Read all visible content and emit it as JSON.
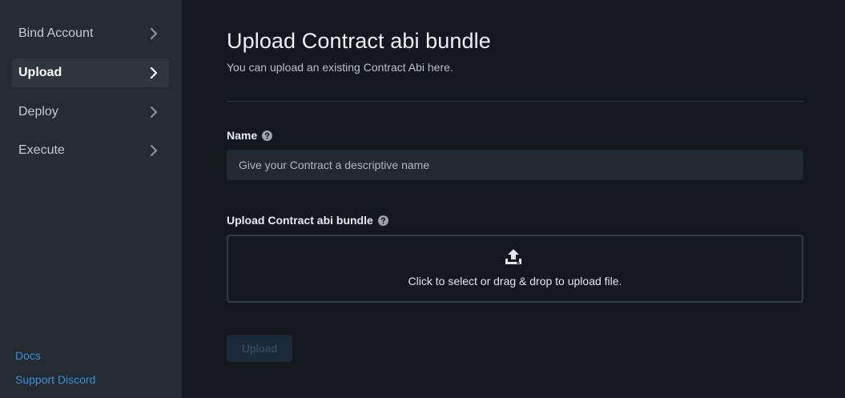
{
  "sidebar": {
    "items": [
      {
        "label": "Bind Account"
      },
      {
        "label": "Upload"
      },
      {
        "label": "Deploy"
      },
      {
        "label": "Execute"
      }
    ],
    "footer": {
      "docs": "Docs",
      "discord": "Support Discord"
    }
  },
  "main": {
    "title": "Upload Contract abi bundle",
    "subtitle": "You can upload an existing Contract Abi here.",
    "name_field": {
      "label": "Name",
      "placeholder": "Give your Contract a descriptive name"
    },
    "bundle_field": {
      "label": "Upload Contract abi bundle",
      "dropzone_text": "Click to select or drag & drop to upload file."
    },
    "submit_label": "Upload"
  },
  "colors": {
    "sidebar_bg": "#232b33",
    "main_bg": "#14181d",
    "link": "#3c8fd8",
    "disabled_button_bg": "#1b2a38"
  }
}
